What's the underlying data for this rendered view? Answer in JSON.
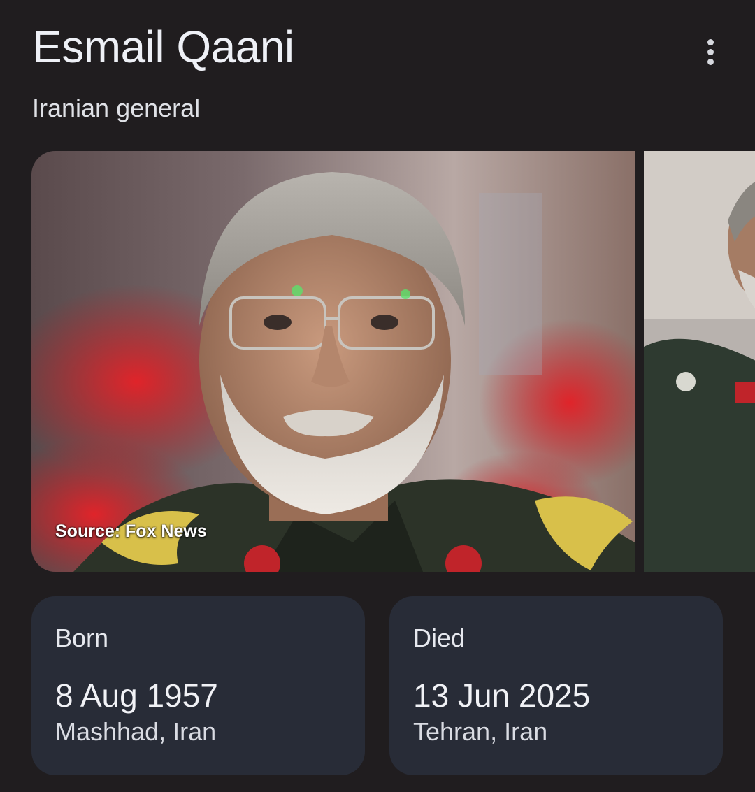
{
  "entity": {
    "title": "Esmail Qaani",
    "subtitle": "Iranian general"
  },
  "menu": {
    "icon": "more-vert-icon"
  },
  "images": {
    "main_source": "Source: Fox News"
  },
  "facts": {
    "born": {
      "label": "Born",
      "date": "8 Aug 1957",
      "place": "Mashhad, Iran"
    },
    "died": {
      "label": "Died",
      "date": "13 Jun 2025",
      "place": "Tehran, Iran"
    }
  },
  "colors": {
    "background": "#201d1f",
    "card": "#282c37",
    "text": "#eef0f6"
  }
}
